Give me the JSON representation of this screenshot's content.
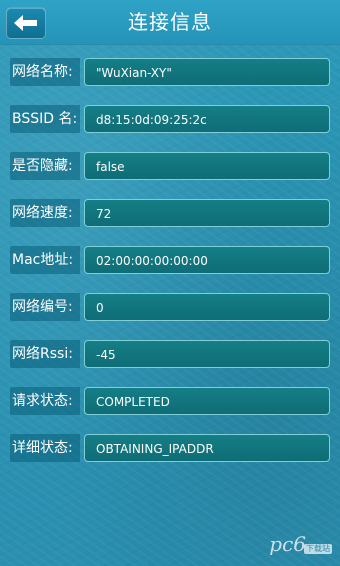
{
  "header": {
    "title": "连接信息",
    "back_icon": "back-arrow-icon"
  },
  "rows": [
    {
      "label": "网络名称:",
      "value": "\"WuXian-XY\""
    },
    {
      "label": "BSSID 名:",
      "value": "d8:15:0d:09:25:2c"
    },
    {
      "label": "是否隐藏:",
      "value": "false"
    },
    {
      "label": "网络速度:",
      "value": "72"
    },
    {
      "label": "Mac地址:",
      "value": "02:00:00:00:00:00"
    },
    {
      "label": "网络编号:",
      "value": "0"
    },
    {
      "label": "网络Rssi:",
      "value": "-45"
    },
    {
      "label": "请求状态:",
      "value": "COMPLETED"
    },
    {
      "label": "详细状态:",
      "value": "OBTAINING_IPADDR"
    }
  ],
  "watermark": {
    "text": "pc6",
    "badge": "下载站"
  },
  "colors": {
    "background": "#2a95b5",
    "value_box": "#117580",
    "value_border": "#7fd0d6"
  }
}
